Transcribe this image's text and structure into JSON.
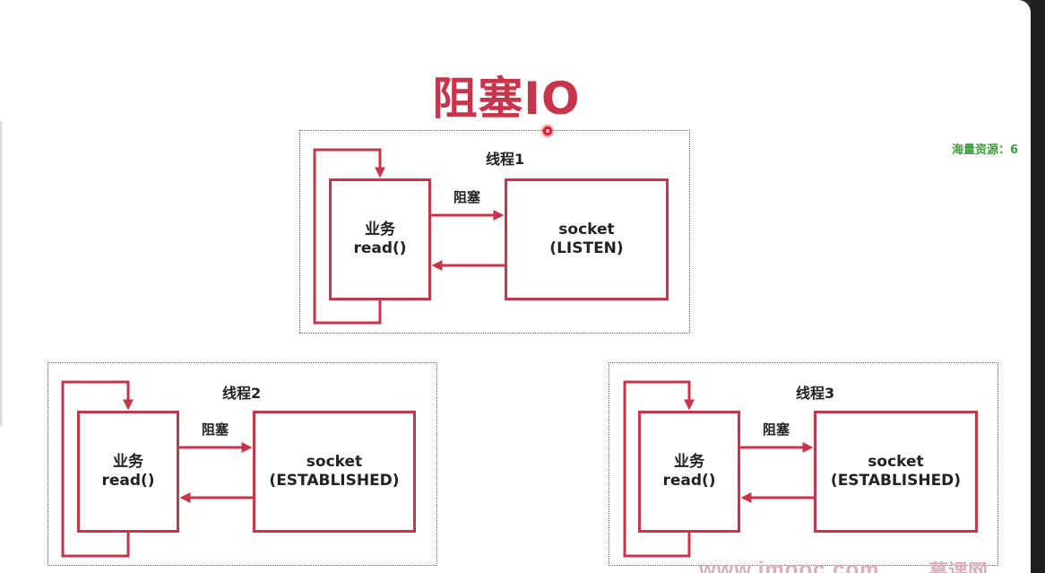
{
  "title": "阻塞IO",
  "side_text": "海量资源：6",
  "watermark": "www.imooc.com",
  "watermark_brand": "慕课网",
  "accent_color": "#c8344a",
  "threads": [
    {
      "label": "线程1",
      "business_line1": "业务",
      "business_line2": "read()",
      "block_label": "阻塞",
      "socket_line1": "socket",
      "socket_line2": "(LISTEN)"
    },
    {
      "label": "线程2",
      "business_line1": "业务",
      "business_line2": "read()",
      "block_label": "阻塞",
      "socket_line1": "socket",
      "socket_line2": "(ESTABLISHED)"
    },
    {
      "label": "线程3",
      "business_line1": "业务",
      "business_line2": "read()",
      "block_label": "阻塞",
      "socket_line1": "socket",
      "socket_line2": "(ESTABLISHED)"
    }
  ]
}
